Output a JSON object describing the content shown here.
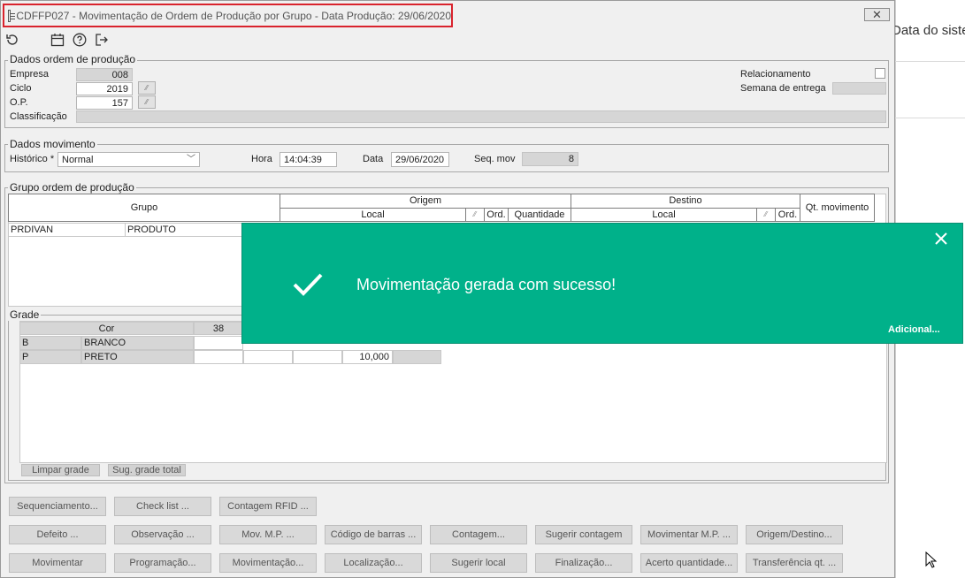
{
  "background_app": {
    "partial_text": "Data do siste"
  },
  "window": {
    "title": "CDFFP027 - Movimentação de Ordem de Produção por Grupo - Data Produção: 29/06/2020",
    "close_icon": "close-icon",
    "toolbar_icons": [
      "refresh-icon",
      "calendar-icon",
      "help-icon",
      "exit-icon"
    ]
  },
  "dados_ordem": {
    "legend": "Dados ordem de produção",
    "empresa_label": "Empresa",
    "empresa_value": "008",
    "ciclo_label": "Ciclo",
    "ciclo_value": "2019",
    "op_label": "O.P.",
    "op_value": "157",
    "classificacao_label": "Classificação",
    "classificacao_value": "",
    "relacionamento_label": "Relacionamento",
    "semana_label": "Semana de entrega",
    "semana_value": ""
  },
  "dados_movimento": {
    "legend": "Dados movimento",
    "historico_label": "Histórico *",
    "historico_value": "Normal",
    "hora_label": "Hora",
    "hora_value": "14:04:39",
    "data_label": "Data",
    "data_value": "29/06/2020",
    "seq_label": "Seq. mov",
    "seq_value": "8"
  },
  "grupo_ordem": {
    "legend": "Grupo ordem de produção",
    "headers": {
      "grupo": "Grupo",
      "origem": "Origem",
      "destino": "Destino",
      "local": "Local",
      "ord": "Ord.",
      "quantidade": "Quantidade",
      "destino_local": "Local",
      "destino_ord": "Ord.",
      "qt_movimento": "Qt. movimento"
    },
    "rows": [
      {
        "grupo": "PRDIVAN",
        "descricao": "PRODUTO"
      }
    ]
  },
  "grade": {
    "legend": "Grade",
    "cor_header": "Cor",
    "size_header": "38",
    "rows": [
      {
        "code": "B",
        "name": "BRANCO",
        "value": ""
      },
      {
        "code": "P",
        "name": "PRETO",
        "value": "10,000"
      }
    ],
    "limpar_label": "Limpar grade",
    "sug_label": "Sug. grade total"
  },
  "buttons": {
    "row1": [
      "Sequenciamento...",
      "Check list ...",
      "Contagem RFID ..."
    ],
    "row2": [
      "Defeito ...",
      "Observação ...",
      "Mov. M.P. ...",
      "Código de barras ...",
      "Contagem...",
      "Sugerir contagem",
      "Movimentar M.P. ...",
      "Origem/Destino..."
    ],
    "row3": [
      "Movimentar",
      "Programação...",
      "Movimentação...",
      "Localização...",
      "Sugerir local",
      "Finalização...",
      "Acerto quantidade...",
      "Transferência qt. ..."
    ]
  },
  "toast": {
    "message": "Movimentação gerada com sucesso!",
    "more": "Adicional...",
    "color": "#00b18a"
  }
}
